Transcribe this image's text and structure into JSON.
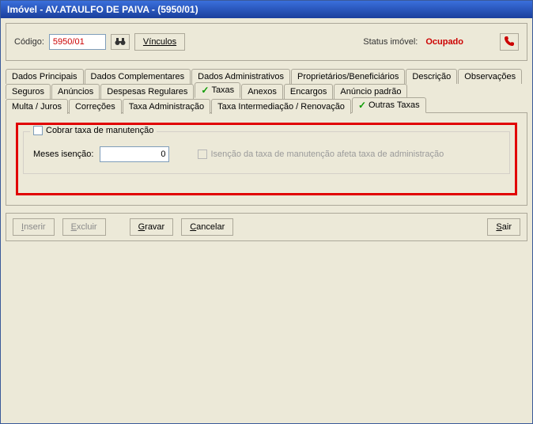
{
  "titlebar": "Imóvel - AV.ATAULFO DE PAIVA  - (5950/01)",
  "top": {
    "code_label": "Código:",
    "code_value": "5950/01",
    "vinculos": "Vínculos",
    "status_label": "Status imóvel:",
    "status_value": "Ocupado"
  },
  "tabs": {
    "r1": [
      "Dados Principais",
      "Dados Complementares",
      "Dados Administrativos",
      "Proprietários/Beneficiários",
      "Descrição",
      "Observações"
    ],
    "r2": [
      "Seguros",
      "Anúncios",
      "Despesas Regulares",
      "Taxas",
      "Anexos",
      "Encargos",
      "Anúncio padrão"
    ],
    "r3": [
      "Multa / Juros",
      "Correções",
      "Taxa Administração",
      "Taxa Intermediação / Renovação",
      "Outras Taxas"
    ]
  },
  "group": {
    "legend": "Cobrar taxa de manutenção",
    "meses_label": "Meses isenção:",
    "meses_value": "0",
    "disabled_label": "Isenção da taxa de manutenção afeta taxa de administração"
  },
  "buttons": {
    "inserir": "Inserir",
    "excluir": "Excluir",
    "gravar": "Gravar",
    "cancelar": "Cancelar",
    "sair": "Sair"
  }
}
